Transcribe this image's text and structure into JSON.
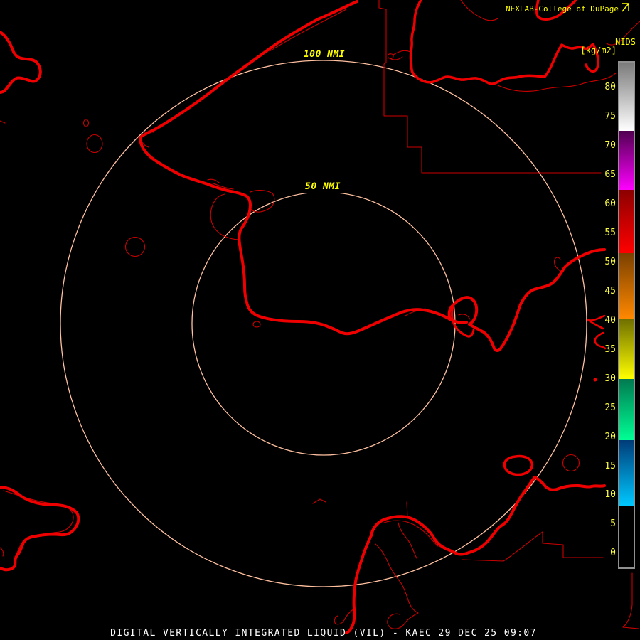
{
  "title": {
    "text": "NEXLAB-College of DuPage",
    "icon": "dupage-flag-icon"
  },
  "colorbar": {
    "title": "NIDS",
    "units": "[kg/m2]",
    "value_top": 84.3,
    "value_bottom": -2.4,
    "ticks": [
      80,
      75,
      70,
      65,
      60,
      55,
      50,
      45,
      40,
      35,
      30,
      25,
      20,
      15,
      10,
      5,
      0
    ],
    "segments": [
      {
        "from": 84.3,
        "to": 72.6,
        "top_color": "#7a7a7a",
        "bottom_color": "#ffffff"
      },
      {
        "from": 72.6,
        "to": 62.4,
        "top_color": "#500050",
        "bottom_color": "#ff00ff"
      },
      {
        "from": 62.4,
        "to": 51.6,
        "top_color": "#8c0000",
        "bottom_color": "#ff0000"
      },
      {
        "from": 51.6,
        "to": 40.3,
        "top_color": "#7a4000",
        "bottom_color": "#ff8800"
      },
      {
        "from": 40.3,
        "to": 30.0,
        "top_color": "#6e6e00",
        "bottom_color": "#ffff00"
      },
      {
        "from": 30.0,
        "to": 19.4,
        "top_color": "#007a50",
        "bottom_color": "#00ff95"
      },
      {
        "from": 19.4,
        "to": 8.2,
        "top_color": "#003c78",
        "bottom_color": "#00c8ff"
      },
      {
        "from": 8.2,
        "to": -2.4,
        "top_color": "#000000",
        "bottom_color": "#000000"
      }
    ]
  },
  "rings": {
    "outer_label": "100 NMI",
    "inner_label": "50 NMI"
  },
  "caption": "DIGITAL VERTICALLY INTEGRATED LIQUID (VIL) - KAEC 29 DEC 25 09:07",
  "map": {
    "background": "#000000",
    "coastline_color": "#ee0000",
    "boundary_color": "#cc0000",
    "ring_color": "#ffc0a0"
  }
}
